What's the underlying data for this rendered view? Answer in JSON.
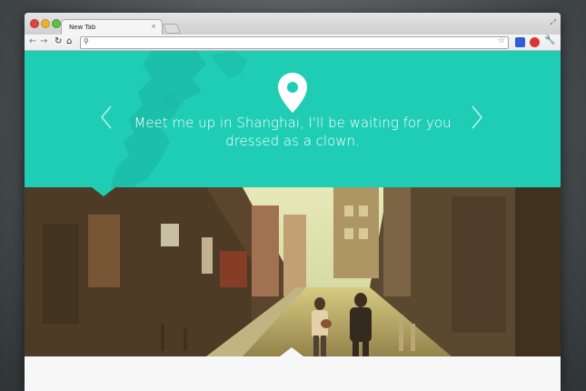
{
  "browser": {
    "tab_title": "New Tab",
    "tab_close": "×",
    "url": "",
    "icons": {
      "back": "back-arrow-icon",
      "forward": "forward-arrow-icon",
      "reload": "reload-icon",
      "home": "home-icon",
      "search": "search-icon",
      "bookmark": "star-icon",
      "settings": "wrench-icon"
    }
  },
  "hero": {
    "quote": "Meet me up in Shanghai, I'll be waiting for you dressed as a clown.",
    "background_color": "#1fcdb5",
    "text_color": "#ffffff"
  },
  "colors": {
    "accent": "#1fcdb5",
    "page_background": "#f7f7f7"
  }
}
